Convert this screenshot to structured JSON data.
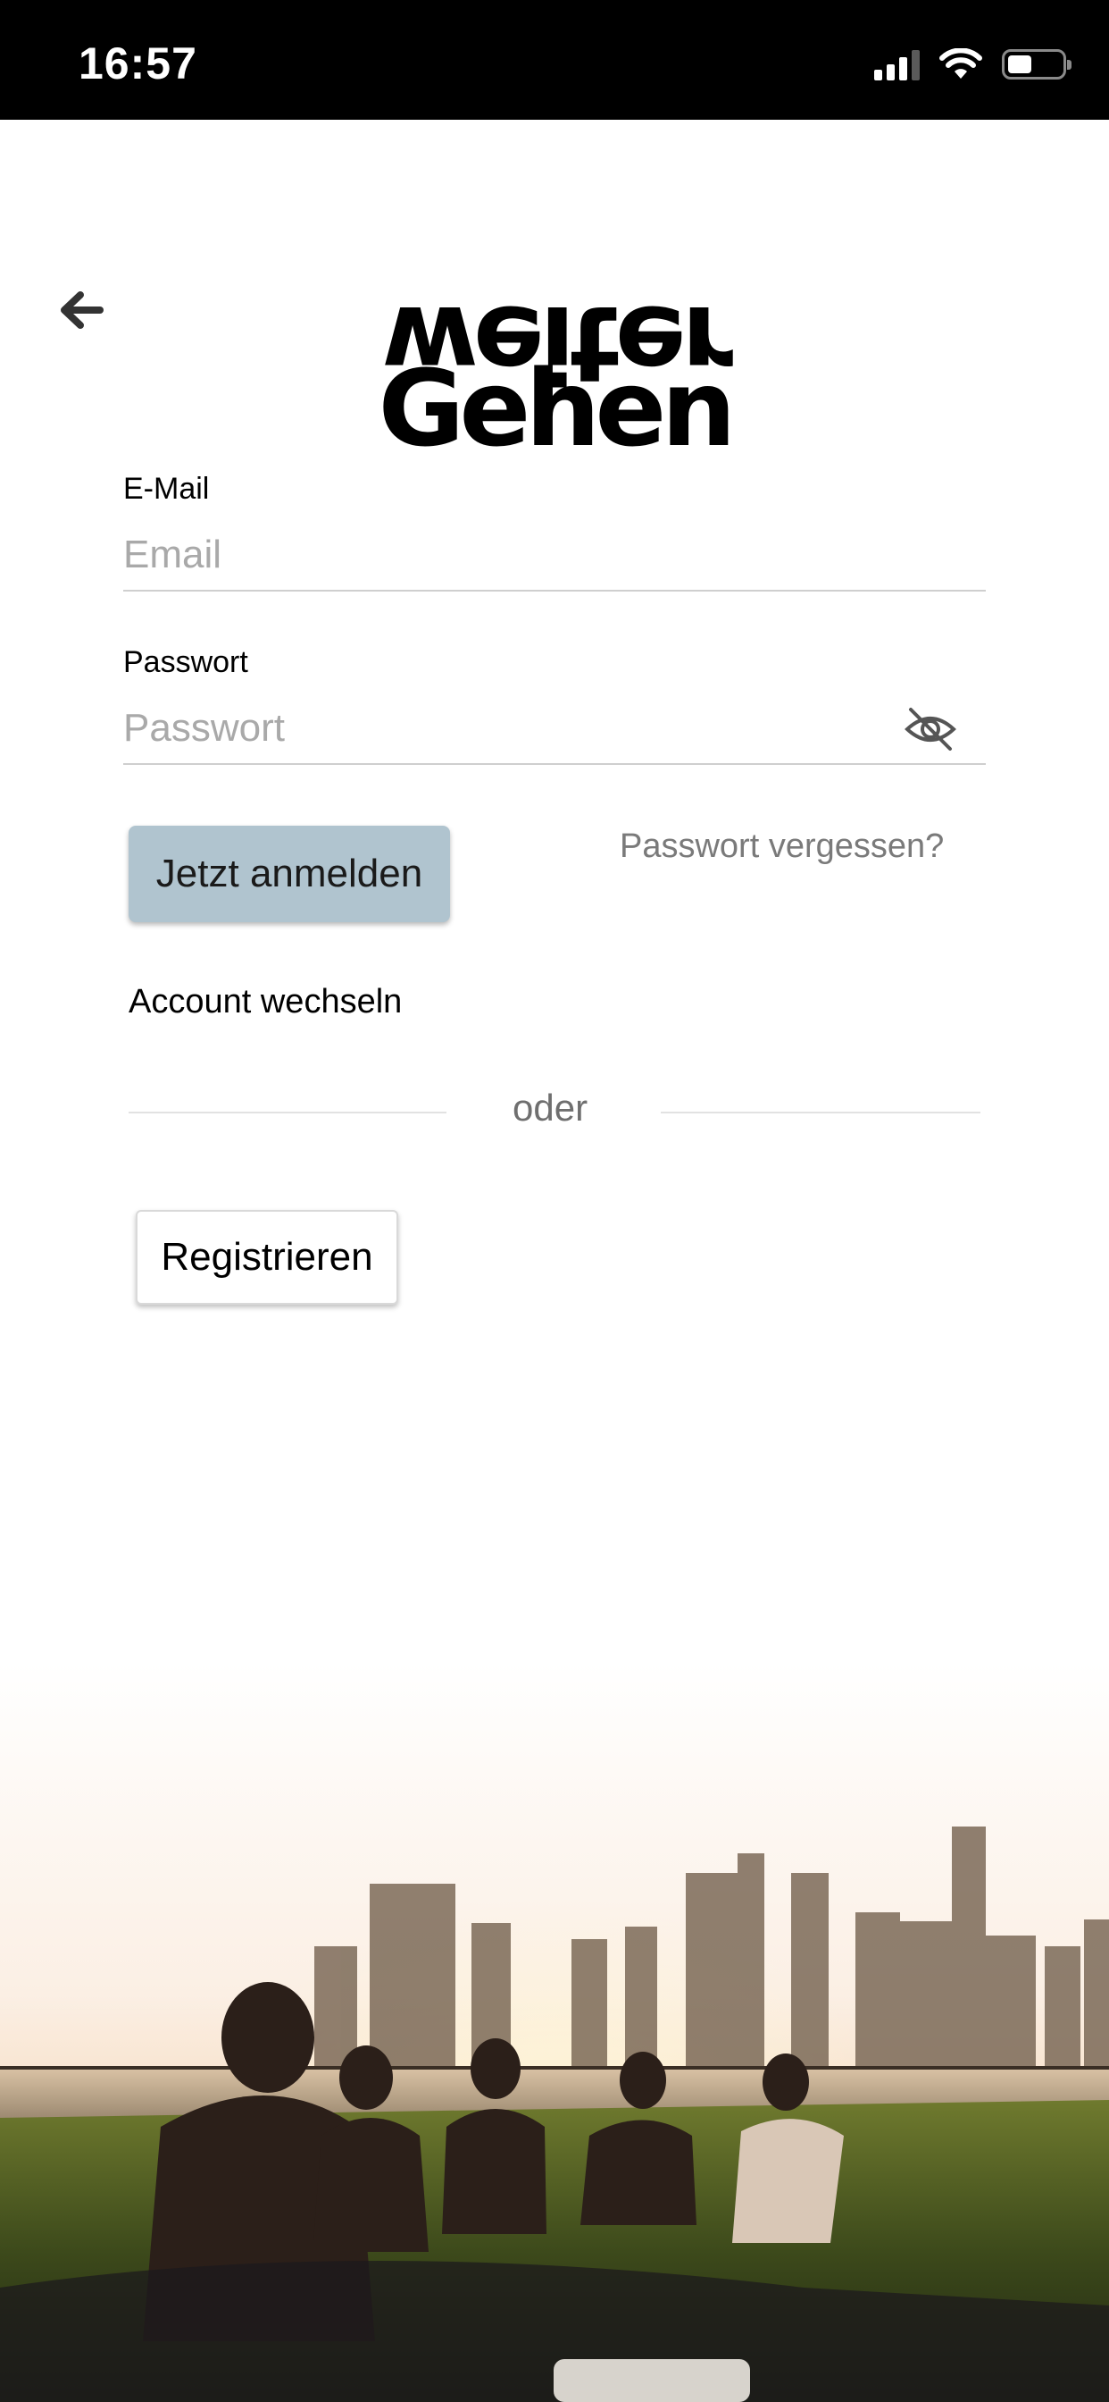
{
  "status_bar": {
    "time": "16:57",
    "icons": [
      "cellular-signal-icon",
      "wifi-icon",
      "battery-icon"
    ]
  },
  "nav": {
    "back_icon": "arrow-left-icon"
  },
  "logo": {
    "line1": "weiter",
    "line2": "Gehen"
  },
  "form": {
    "email_label": "E-Mail",
    "email_placeholder": "Email",
    "email_value": "",
    "password_label": "Passwort",
    "password_placeholder": "Passwort",
    "password_value": "",
    "password_toggle_icon": "eye-slash-icon"
  },
  "actions": {
    "login_label": "Jetzt anmelden",
    "forgot_label": "Passwort vergessen?",
    "switch_account_label": "Account wechseln",
    "divider_label": "oder",
    "register_label": "Registrieren"
  },
  "colors": {
    "login_button": "#b0c4cf",
    "status_bar": "#000000",
    "link_gray": "#7a7a7a"
  }
}
